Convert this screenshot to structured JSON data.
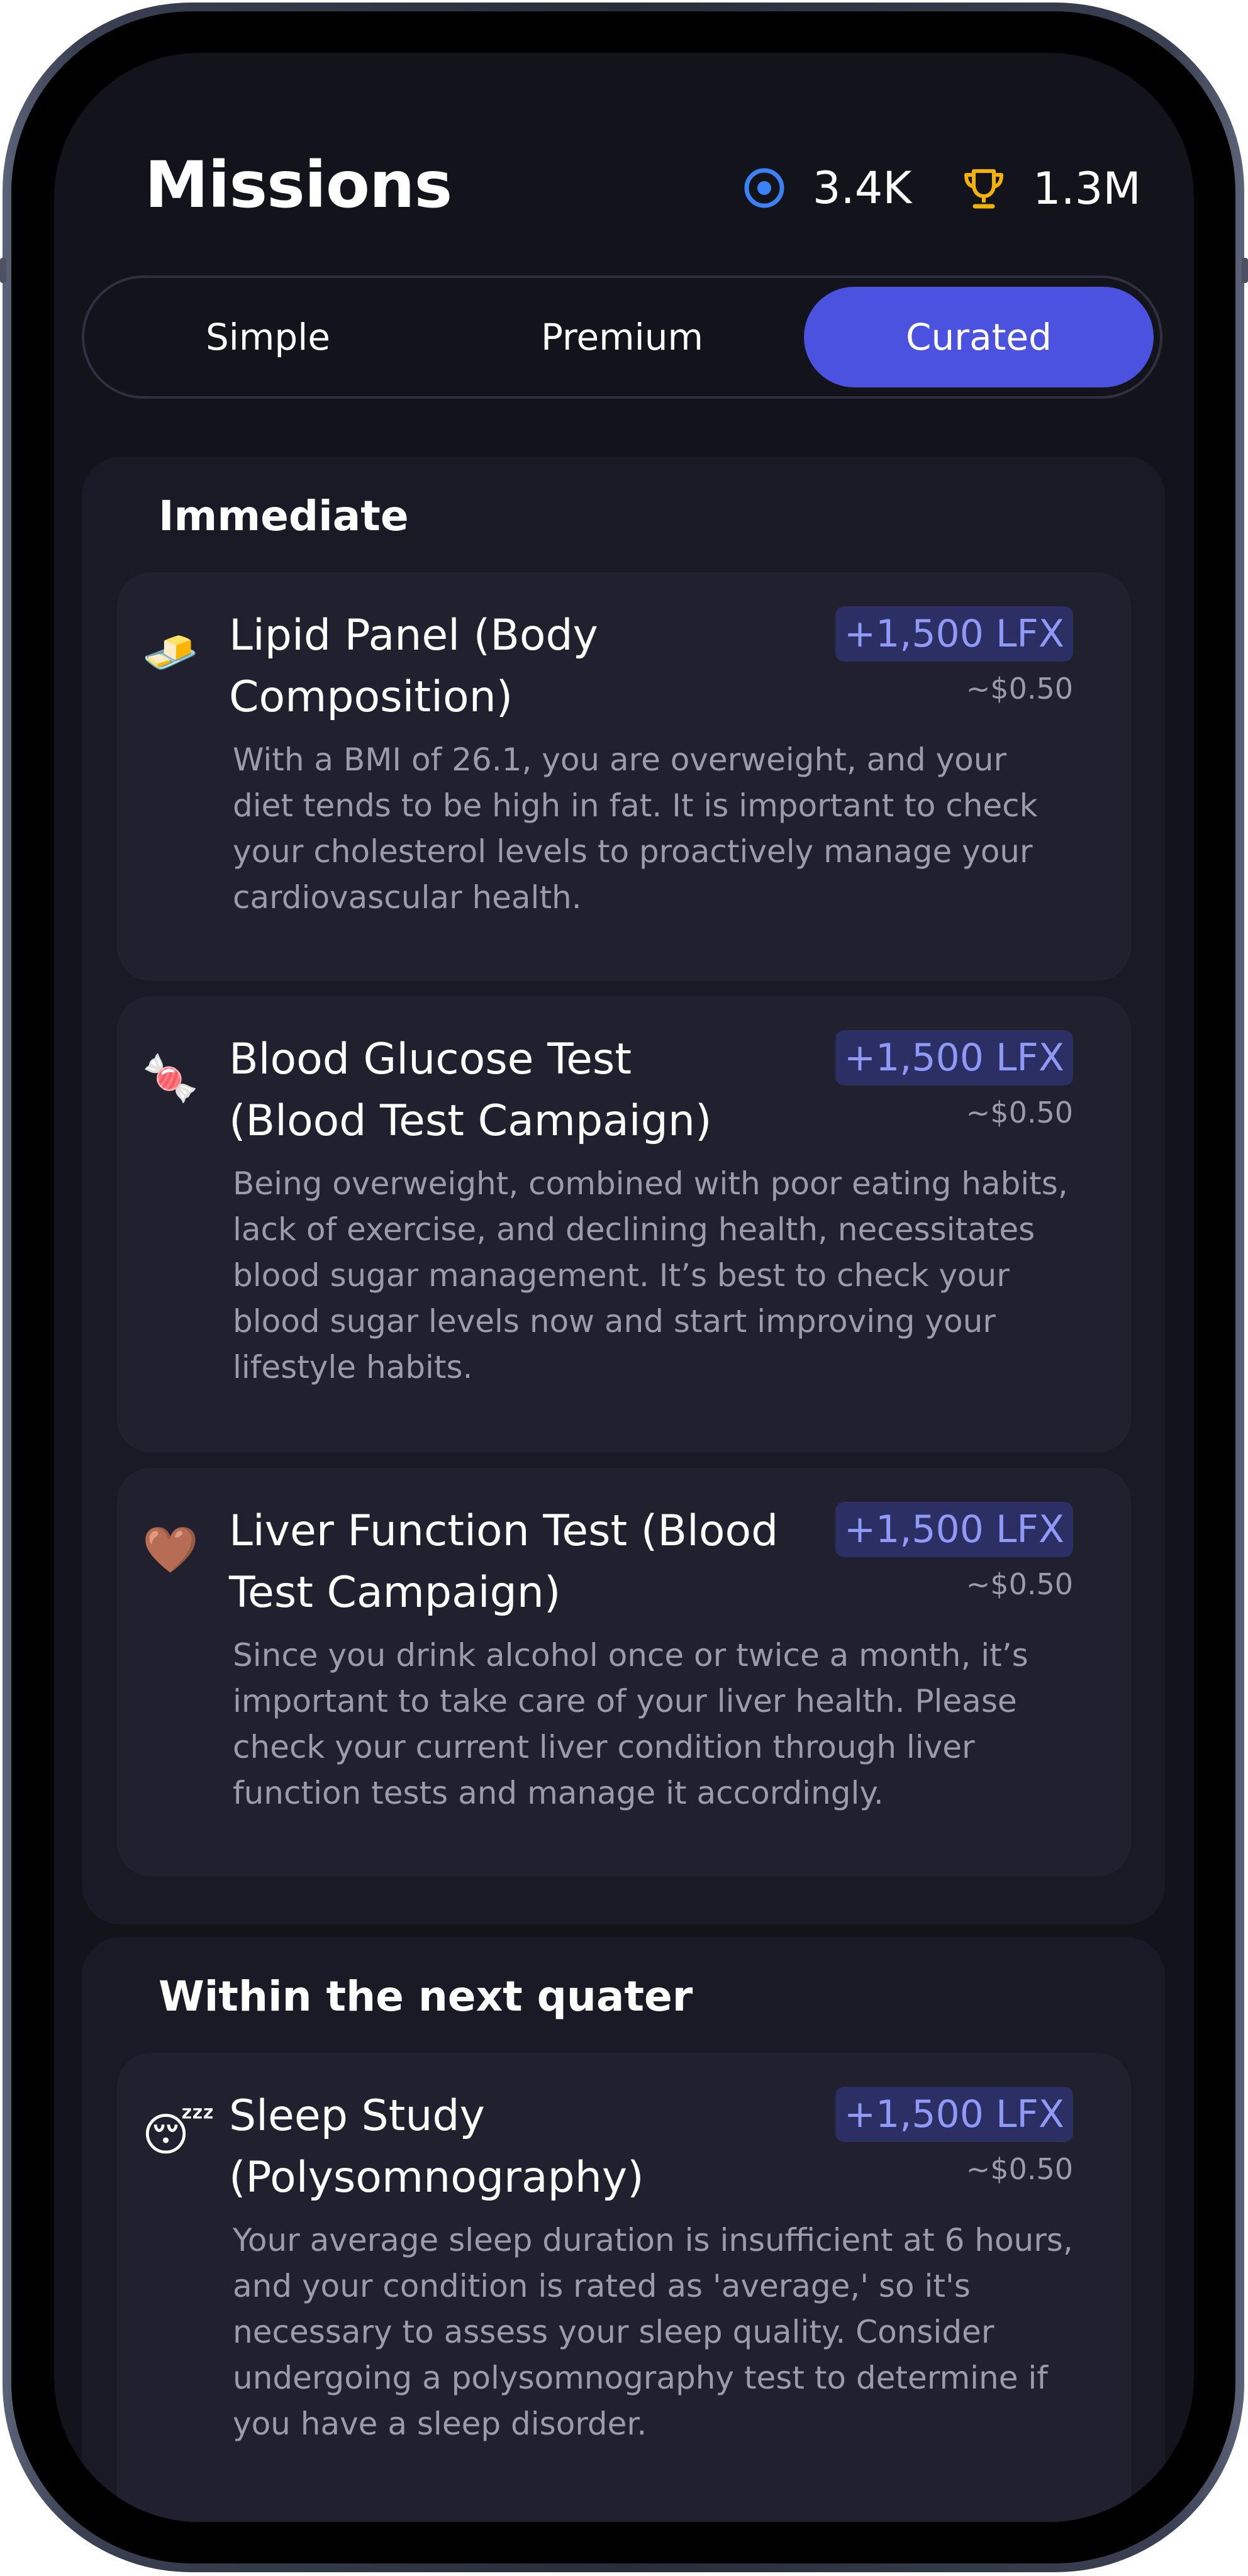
{
  "header": {
    "title": "Missions",
    "coins": "3.4K",
    "trophies": "1.3M"
  },
  "tabs": [
    {
      "label": "Simple",
      "active": false
    },
    {
      "label": "Premium",
      "active": false
    },
    {
      "label": "Curated",
      "active": true
    }
  ],
  "sections": [
    {
      "title": "Immediate",
      "cards": [
        {
          "icon": "butter-emoji",
          "emoji": "🧈",
          "title": "Lipid Panel (Body Composition)",
          "reward": "+1,500 LFX",
          "usd": "~$0.50",
          "description": "With a BMI of 26.1, you are overweight, and your diet tends to be high in fat. It is important to check your cholesterol levels to proactively manage your cardiovascular health."
        },
        {
          "icon": "candy-emoji",
          "emoji": "🍬",
          "title": "Blood Glucose Test (Blood Test Campaign)",
          "reward": "+1,500 LFX",
          "usd": "~$0.50",
          "description": "Being overweight, combined with poor eating habits, lack of exercise, and declining health, necessitates blood sugar management. It’s best to check your blood sugar levels now and start improving your lifestyle habits."
        },
        {
          "icon": "brown-heart-emoji",
          "emoji": "🤎",
          "title": "Liver Function Test (Blood Test Campaign)",
          "reward": "+1,500 LFX",
          "usd": "~$0.50",
          "description": "Since you drink alcohol once or twice a month, it’s important to take care of your liver health. Please check your current liver condition through liver function tests and manage it accordingly."
        }
      ]
    },
    {
      "title": "Within the next quater",
      "cards": [
        {
          "icon": "sleeping-face-emoji",
          "emoji": "😴",
          "title": "Sleep Study (Polysomnography)",
          "reward": "+1,500 LFX",
          "usd": "~$0.50",
          "description": "Your average sleep duration is insufficient at 6 hours, and your condition is rated as 'average,' so it's necessary to assess your sleep quality. Consider undergoing a polysomnography test to determine if you have a sleep disorder."
        }
      ]
    }
  ],
  "colors": {
    "background": "#13131c",
    "section": "#1a1a26",
    "card": "#20202e",
    "accent": "#4b52e0",
    "reward_text": "#8f9af7",
    "reward_bg": "#2c2f63",
    "coin_icon": "#3b82f6",
    "trophy_icon": "#f5b301"
  }
}
